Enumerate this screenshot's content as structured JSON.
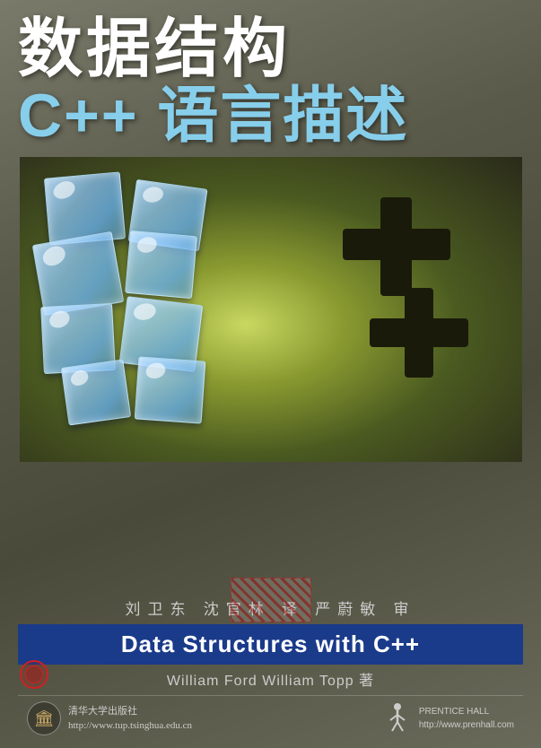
{
  "cover": {
    "title_line1": "数据结构",
    "title_line2": "C++ 语言描述",
    "subtitle": "Data Structures with C++",
    "translators": "刘卫东  沈官林  译  严蔚敏  审",
    "authors": "William Ford  William Topp  著",
    "publisher_cn_name": "清华大学出版社",
    "publisher_cn_url": "http://www.tup.tsinghua.edu.cn",
    "publisher_en_name": "PRENTICE HALL",
    "publisher_en_url": "http://www.prenhall.com"
  },
  "icons": {
    "tsinghua_logo": "🏛",
    "prentice_hall_logo": "🦅"
  }
}
